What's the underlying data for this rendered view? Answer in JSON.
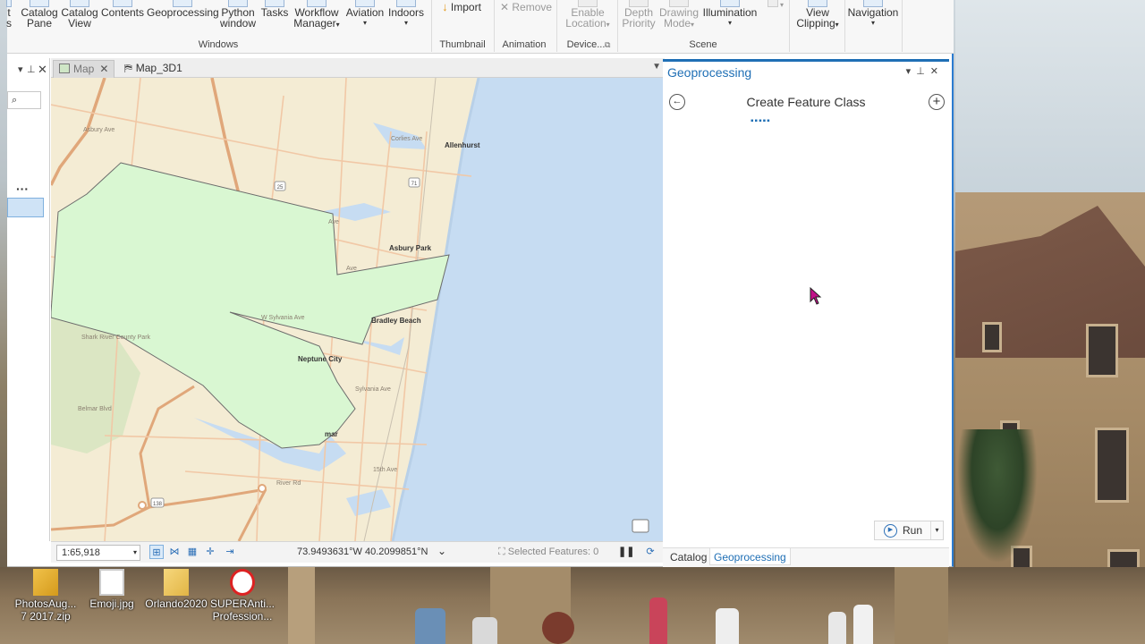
{
  "ribbon": {
    "windows_group": {
      "label": "Windows",
      "buttons": [
        {
          "line1": "t",
          "line2": "s"
        },
        {
          "line1": "Catalog",
          "line2": "Pane"
        },
        {
          "line1": "Catalog",
          "line2": "View"
        },
        {
          "line1": "Contents",
          "line2": ""
        },
        {
          "line1": "Geoprocessing",
          "line2": ""
        },
        {
          "line1": "Python",
          "line2": "window"
        },
        {
          "line1": "Tasks",
          "line2": ""
        },
        {
          "line1": "Workflow",
          "line2": "Manager"
        },
        {
          "line1": "Aviation",
          "line2": ""
        },
        {
          "line1": "Indoors",
          "line2": ""
        }
      ]
    },
    "thumbnail_group": {
      "label": "Thumbnail",
      "import_label": "Import"
    },
    "animation_group": {
      "label": "Animation",
      "remove_label": "Remove"
    },
    "device_group": {
      "label": "Device...",
      "line1": "Enable",
      "line2": "Location"
    },
    "scene_group": {
      "label": "Scene",
      "depth": {
        "line1": "Depth",
        "line2": "Priority"
      },
      "drawing": {
        "line1": "Drawing",
        "line2": "Mode"
      },
      "illumination": "Illumination"
    },
    "view_clipping": {
      "line1": "View",
      "line2": "Clipping"
    },
    "navigation": "Navigation"
  },
  "map_tabs": [
    {
      "label": "Map",
      "active": true
    },
    {
      "label": "Map_3D1",
      "active": false
    }
  ],
  "map_labels": {
    "allenhurst": "Allenhurst",
    "asbury": "Asbury Park",
    "bradley": "Bradley Beach",
    "neptune": "Neptune City",
    "shark": "Shark River County Park",
    "belmar": "mar",
    "route25": "25",
    "route71": "71",
    "route138": "138",
    "road_ave1": "Ave",
    "road_ave2": "Ave",
    "road_sylvania": "Sylvania Ave",
    "road_wsylvania": "W Sylvania Ave",
    "road_belmar": "Belmar Blvd",
    "road_river": "River Rd",
    "road_15th": "15th Ave",
    "road_asbury": "Asbury Ave",
    "road_corlies": "Corlies Ave"
  },
  "status_bar": {
    "scale": "1:65,918",
    "coordinates": "73.9493631°W 40.2099851°N",
    "selected_features": "Selected Features: 0"
  },
  "geoprocessing": {
    "title": "Geoprocessing",
    "tool_name": "Create Feature Class",
    "run_label": "Run",
    "tabs": [
      "Catalog",
      "Geoprocessing"
    ],
    "active_tab": "Geoprocessing"
  },
  "desktop_icons": [
    {
      "line1": "PhotosAug...",
      "line2": "7 2017.zip"
    },
    {
      "line1": "Emoji.jpg",
      "line2": ""
    },
    {
      "line1": "Orlando2020",
      "line2": ""
    },
    {
      "line1": "SUPERAnti...",
      "line2": "Profession..."
    }
  ],
  "colors": {
    "accent": "#1f6fb5",
    "polygon_fill": "#d9f7d2",
    "water": "#c6dcf2",
    "land": "#f4ecd4",
    "cursor": "#c20f8a"
  }
}
